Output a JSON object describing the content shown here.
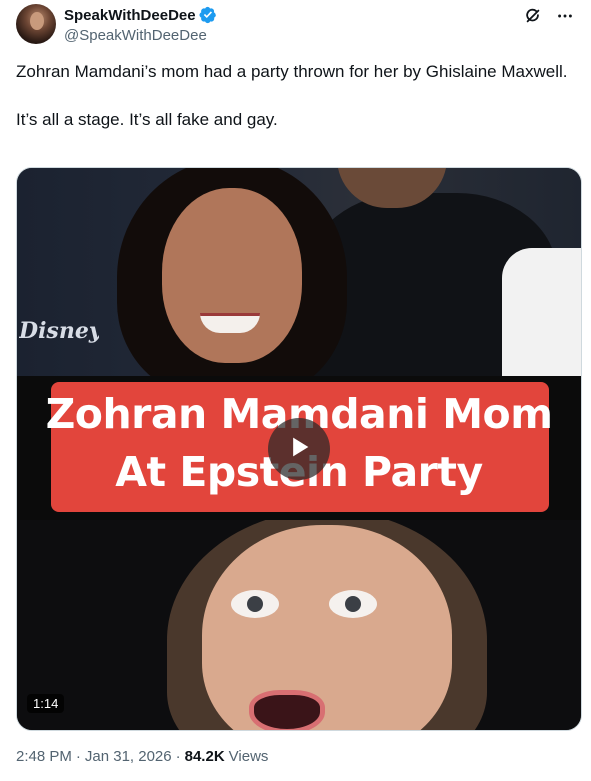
{
  "author": {
    "display_name": "SpeakWithDeeDee",
    "handle": "@SpeakWithDeeDee",
    "verified_color": "#1d9bf0"
  },
  "tweet": {
    "paragraph_1": "Zohran Mamdani’s mom had a party thrown for her by Ghislaine Maxwell.",
    "paragraph_2": "It’s all a stage. It’s all fake and gay."
  },
  "media": {
    "overlay_logo": "DISNEY",
    "title_line_1": "Zohran Mamdani Mom",
    "title_line_2": "At Epstein Party",
    "title_box_color": "#e2453c",
    "duration": "1:14"
  },
  "meta": {
    "time": "2:48 PM",
    "separator": "·",
    "date": "Jan 31, 2026",
    "views_count": "84.2K",
    "views_label": "Views"
  },
  "icons": {
    "verified": "verified-badge-icon",
    "grok": "grok-icon",
    "more": "more-icon",
    "play": "play-icon"
  }
}
